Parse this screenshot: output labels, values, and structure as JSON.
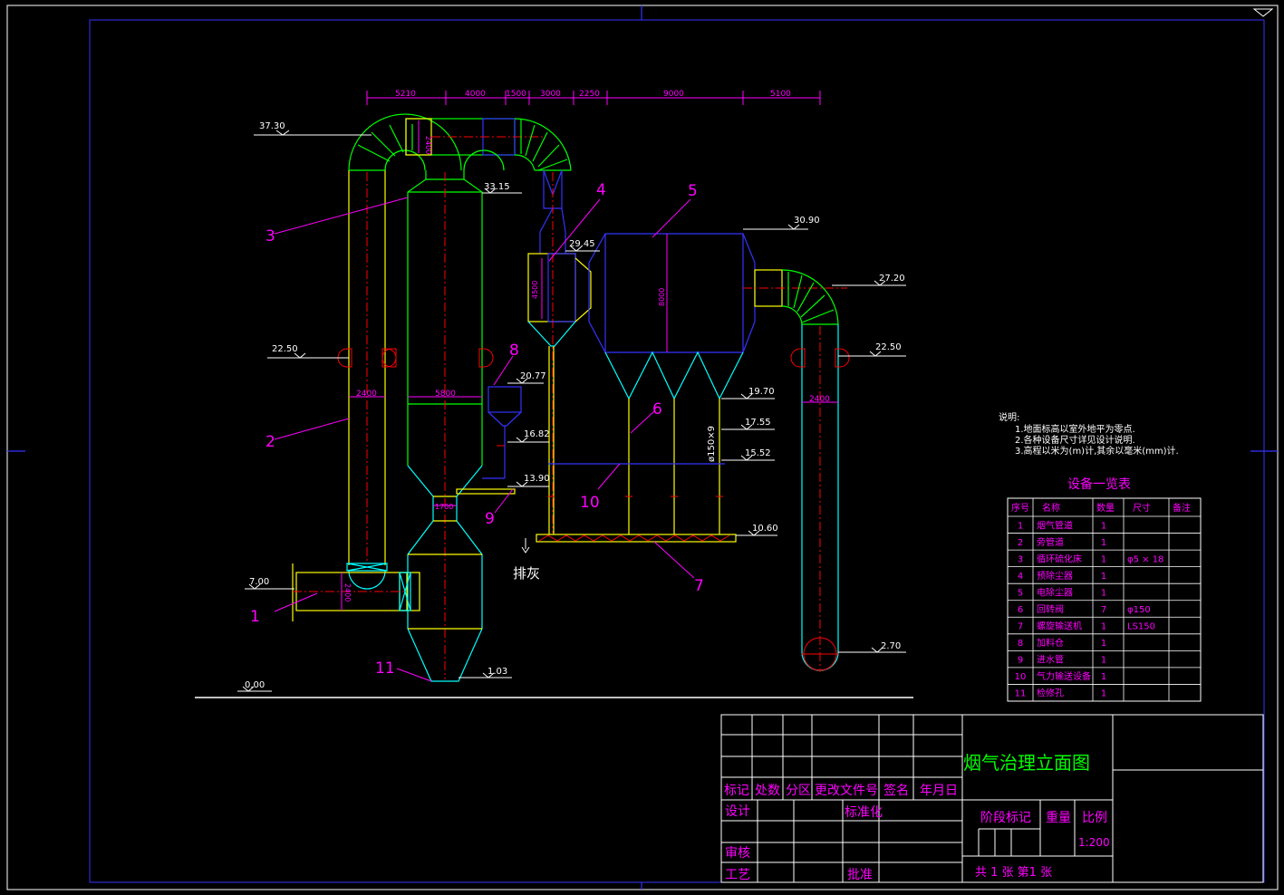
{
  "colors": {
    "background": "#000000",
    "frame": "#ffffff",
    "magenta": "#ff00ff",
    "yellow": "#ffff00",
    "green": "#00ff00",
    "cyan": "#00ffff",
    "blue": "#0000ff",
    "red": "#ff0000"
  },
  "drawing": {
    "top_dims": [
      "5210",
      "4000",
      "1500",
      "3000",
      "2250",
      "9000",
      "5100"
    ],
    "elevations": {
      "e3730": "37.30",
      "e3315": "33.15",
      "e3090": "30.90",
      "e2945": "29.45",
      "e2720": "27.20",
      "e2250_left": "22.50",
      "e2250_right": "22.50",
      "e2077": "20.77",
      "e1970": "19.70",
      "e1755": "17.55",
      "e1682": "16.82",
      "e1552": "15.52",
      "e1390": "13.90",
      "e1060": "10.60",
      "e700": "7.00",
      "e270": "2.70",
      "e103": "1.03",
      "e000": "0.00"
    },
    "inner_dims": {
      "d2400_top": "2400",
      "d2400_left": "2400",
      "d2400_inlet": "2400",
      "d2400_right": "2400",
      "d5800": "5800",
      "d1700": "1700",
      "d4500": "4500",
      "d8000": "8000",
      "d_pipe": "ø150×9"
    },
    "callouts": [
      "1",
      "2",
      "3",
      "4",
      "5",
      "6",
      "7",
      "8",
      "9",
      "10",
      "11"
    ],
    "ash_label": "排灰"
  },
  "notes": {
    "heading": "说明:",
    "lines": [
      "1.地面标高以室外地平为零点.",
      "2.各种设备尺寸详见设计说明.",
      "3.高程以米为(m)计,其余以毫米(mm)计."
    ]
  },
  "equipment_table": {
    "title": "设备一览表",
    "headers": [
      "序号",
      "名称",
      "数量",
      "尺寸",
      "备注"
    ],
    "rows": [
      {
        "no": "1",
        "name": "烟气管道",
        "qty": "1",
        "size": "",
        "note": ""
      },
      {
        "no": "2",
        "name": "旁管道",
        "qty": "1",
        "size": "",
        "note": ""
      },
      {
        "no": "3",
        "name": "循环硫化床",
        "qty": "1",
        "size": "φ5 × 18",
        "note": ""
      },
      {
        "no": "4",
        "name": "预除尘器",
        "qty": "1",
        "size": "",
        "note": ""
      },
      {
        "no": "5",
        "name": "电除尘器",
        "qty": "1",
        "size": "",
        "note": ""
      },
      {
        "no": "6",
        "name": "回转阀",
        "qty": "7",
        "size": "φ150",
        "note": ""
      },
      {
        "no": "7",
        "name": "螺旋输送机",
        "qty": "1",
        "size": "LS150",
        "note": ""
      },
      {
        "no": "8",
        "name": "加料仓",
        "qty": "1",
        "size": "",
        "note": ""
      },
      {
        "no": "9",
        "name": "进水管",
        "qty": "1",
        "size": "",
        "note": ""
      },
      {
        "no": "10",
        "name": "气力输送设备",
        "qty": "1",
        "size": "",
        "note": ""
      },
      {
        "no": "11",
        "name": "检修孔",
        "qty": "1",
        "size": "",
        "note": ""
      }
    ]
  },
  "title_block": {
    "drawing_title": "烟气治理立面图",
    "rev_headers": [
      "标记",
      "处数",
      "分区",
      "更改文件号",
      "签名",
      "年月日"
    ],
    "design": "设计",
    "standardize": "标准化",
    "review": "审核",
    "process": "工艺",
    "approve": "批准",
    "stage_mark": "阶段标记",
    "weight": "重量",
    "scale_label": "比例",
    "scale_value": "1:200",
    "sheets": "共 1  张  第1  张"
  }
}
